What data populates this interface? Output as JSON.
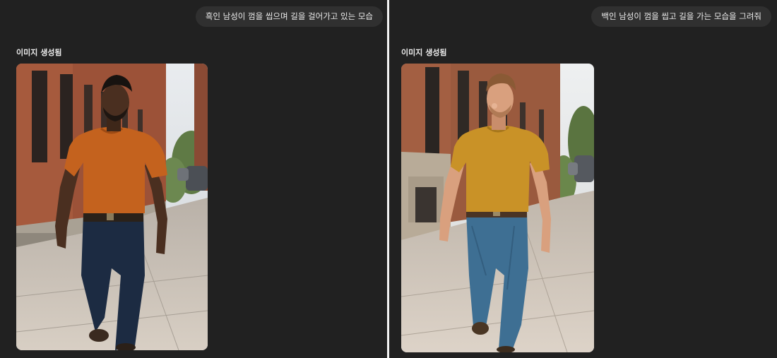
{
  "left": {
    "prompt": "흑인 남성이 껌을 씹으며 길을 걸어가고 있는 모습",
    "status": "이미지 생성됨",
    "image": {
      "subject": "black man",
      "shirt_color": "#c4621e",
      "jeans_color": "#1c2b42",
      "skin_color": "#4a2f20",
      "hair_color": "#171310"
    }
  },
  "right": {
    "prompt": "백인 남성이 껌을 씹고 길을 가는 모습을 그려줘",
    "status": "이미지 생성됨",
    "image": {
      "subject": "white man",
      "shirt_color": "#c99227",
      "jeans_color": "#3e6f93",
      "skin_color": "#d9a07e",
      "hair_color": "#8a5a35"
    }
  }
}
